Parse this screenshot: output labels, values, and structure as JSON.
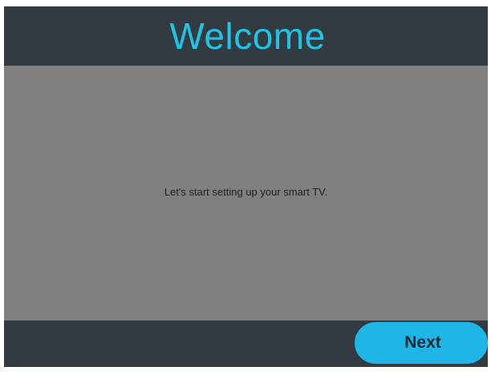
{
  "header": {
    "title": "Welcome"
  },
  "content": {
    "message": "Let's start setting up your smart TV."
  },
  "footer": {
    "next_label": "Next"
  },
  "colors": {
    "accent": "#1fc3e4",
    "button": "#1fb5e6",
    "bar_background": "#323b41",
    "panel_background": "#808080"
  }
}
